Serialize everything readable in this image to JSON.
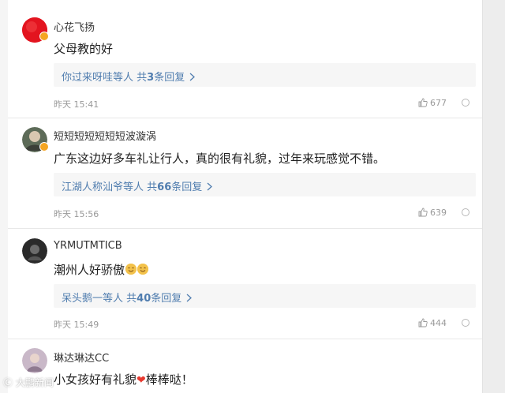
{
  "comments": [
    {
      "username": "心花飞扬",
      "text": "父母教的好",
      "reply_users": "你过来呀哇等人",
      "reply_prefix": "共",
      "reply_count": "3",
      "reply_suffix": "条回复",
      "time": "昨天 15:41",
      "likes": "677"
    },
    {
      "username": "短短短短短短短波漩涡",
      "text": "广东这边好多车礼让行人，真的很有礼貌，过年来玩感觉不错。",
      "reply_users": "江湖人称汕爷等人",
      "reply_prefix": "共",
      "reply_count": "66",
      "reply_suffix": "条回复",
      "time": "昨天 15:56",
      "likes": "639"
    },
    {
      "username": "YRMUTMTICB",
      "text": "潮州人好骄傲",
      "reply_users": "呆头鹅一等人",
      "reply_prefix": "共",
      "reply_count": "40",
      "reply_suffix": "条回复",
      "time": "昨天 15:49",
      "likes": "444"
    },
    {
      "username": "琳达琳达CC",
      "text_before": "小女孩好有礼貌",
      "text_after": "棒棒哒！"
    }
  ],
  "watermark": "大鹏新闻",
  "icons": [
    "like-icon",
    "more-icon",
    "vip-badge-icon",
    "chevron-right-icon",
    "heart-emoji",
    "smile-emoji"
  ],
  "colors": {
    "link": "#507daf",
    "heart": "#e8392f",
    "vip_badge": "#f5a623"
  }
}
